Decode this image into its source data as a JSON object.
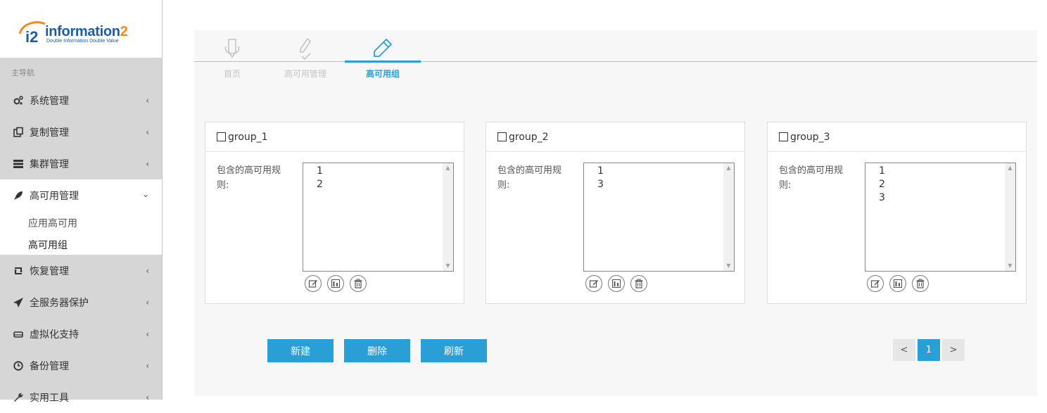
{
  "brand": {
    "name": "information",
    "name_suffix": "2",
    "tagline": "Double Information Double Value",
    "mark": "i2",
    "colors": {
      "blue": "#1e5ba8",
      "orange": "#f08c1e"
    }
  },
  "sidebar": {
    "header": "主导航",
    "items": [
      {
        "label": "系统管理",
        "icon": "gears-icon",
        "expanded": false
      },
      {
        "label": "复制管理",
        "icon": "copy-icon",
        "expanded": false
      },
      {
        "label": "集群管理",
        "icon": "server-rack-icon",
        "expanded": false
      },
      {
        "label": "高可用管理",
        "icon": "rocket-icon",
        "expanded": true
      },
      {
        "label": "恢复管理",
        "icon": "retweet-icon",
        "expanded": false
      },
      {
        "label": "全服务器保护",
        "icon": "paper-plane-icon",
        "expanded": false
      },
      {
        "label": "虚拟化支持",
        "icon": "hdd-icon",
        "expanded": false
      },
      {
        "label": "备份管理",
        "icon": "clock-icon",
        "expanded": false
      },
      {
        "label": "实用工具",
        "icon": "wrench-icon",
        "expanded": false
      }
    ],
    "submenu": [
      {
        "label": "应用高可用",
        "active": false
      },
      {
        "label": "高可用组",
        "active": true
      }
    ]
  },
  "steps": [
    {
      "label": "首页",
      "icon": "pencil-shield-icon",
      "active": false
    },
    {
      "label": "高可用管理",
      "icon": "pencil-check-icon",
      "active": false
    },
    {
      "label": "高可用组",
      "icon": "pencil-icon",
      "active": true
    }
  ],
  "groups": [
    {
      "title": "group_1",
      "rules_label": "包含的高可用规则:",
      "rules": [
        "1",
        "2"
      ]
    },
    {
      "title": "group_2",
      "rules_label": "包含的高可用规则:",
      "rules": [
        "1",
        "3"
      ]
    },
    {
      "title": "group_3",
      "rules_label": "包含的高可用规则:",
      "rules": [
        "1",
        "2",
        "3"
      ]
    }
  ],
  "card_actions": [
    "edit-icon",
    "chart-icon",
    "trash-icon"
  ],
  "buttons": {
    "new": "新建",
    "delete": "删除",
    "refresh": "刷新"
  },
  "pagination": {
    "prev": "<",
    "current": "1",
    "next": ">"
  },
  "colors": {
    "accent": "#2a9fd6",
    "sidebar_bg": "#d6d6d6"
  }
}
